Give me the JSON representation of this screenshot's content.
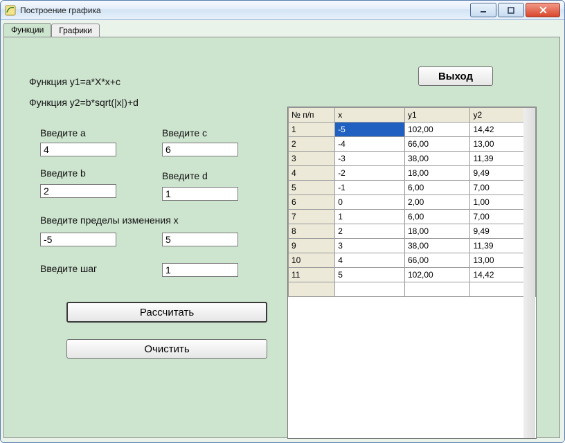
{
  "window": {
    "title": "Построение графика",
    "min_tooltip": "Minimize",
    "max_tooltip": "Maximize",
    "close_tooltip": "Close"
  },
  "tabs": {
    "functions": "Функции",
    "graphs": "Графики"
  },
  "formulas": {
    "y1": "Функция y1=a*X*x+c",
    "y2": "Функция y2=b*sqrt(|x|)+d"
  },
  "labels": {
    "a": "Введите a",
    "b": "Введите b",
    "c": "Введите c",
    "d": "Введите d",
    "range": "Введите пределы изменения x",
    "step": "Введите шаг"
  },
  "inputs": {
    "a": "4",
    "b": "2",
    "c": "6",
    "d": "1",
    "xmin": "-5",
    "xmax": "5",
    "step": "1"
  },
  "buttons": {
    "exit": "Выход",
    "calc": "Рассчитать",
    "clear": "Очистить"
  },
  "table": {
    "headers": [
      "№ п/п",
      "x",
      "y1",
      "y2"
    ],
    "rows": [
      [
        "1",
        "-5",
        "102,00",
        "14,42"
      ],
      [
        "2",
        "-4",
        "66,00",
        "13,00"
      ],
      [
        "3",
        "-3",
        "38,00",
        "11,39"
      ],
      [
        "4",
        "-2",
        "18,00",
        "9,49"
      ],
      [
        "5",
        "-1",
        "6,00",
        "7,00"
      ],
      [
        "6",
        "0",
        "2,00",
        "1,00"
      ],
      [
        "7",
        "1",
        "6,00",
        "7,00"
      ],
      [
        "8",
        "2",
        "18,00",
        "9,49"
      ],
      [
        "9",
        "3",
        "38,00",
        "11,39"
      ],
      [
        "10",
        "4",
        "66,00",
        "13,00"
      ],
      [
        "11",
        "5",
        "102,00",
        "14,42"
      ]
    ],
    "selected": {
      "row": 0,
      "col": 1
    }
  }
}
